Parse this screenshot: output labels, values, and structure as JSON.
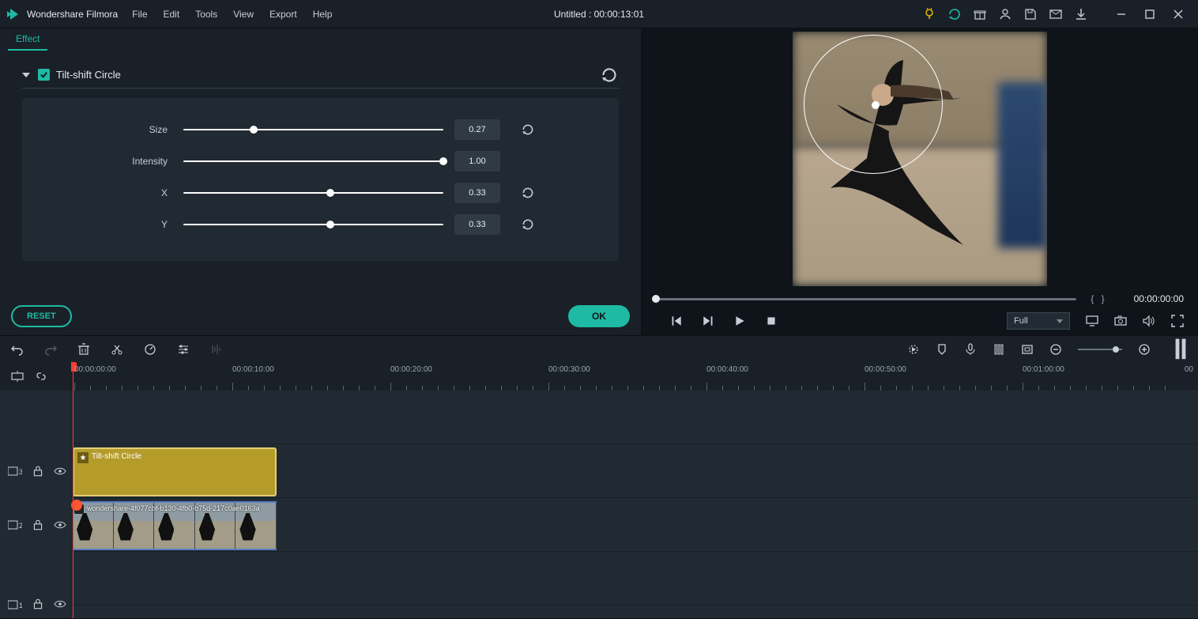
{
  "app": {
    "name": "Wondershare Filmora",
    "project": "Untitled : 00:00:13:01"
  },
  "menu": {
    "file": "File",
    "edit": "Edit",
    "tools": "Tools",
    "view": "View",
    "export": "Export",
    "help": "Help"
  },
  "tab": {
    "effect": "Effect"
  },
  "effect": {
    "name": "Tilt-shift Circle",
    "enabled": true,
    "params": {
      "size": {
        "label": "Size",
        "value": "0.27",
        "slider": 0.27
      },
      "intensity": {
        "label": "Intensity",
        "value": "1.00",
        "slider": 1.0
      },
      "x": {
        "label": "X",
        "value": "0.33",
        "slider": 0.565
      },
      "y": {
        "label": "Y",
        "value": "0.33",
        "slider": 0.565
      }
    }
  },
  "actions": {
    "reset": "RESET",
    "ok": "OK"
  },
  "preview": {
    "quality": "Full",
    "mark_brackets": "{         }",
    "time": "00:00:00:00"
  },
  "ruler": {
    "labels": [
      "00:00:00:00",
      "00:00:10:00",
      "00:00:20:00",
      "00:00:30:00",
      "00:00:40:00",
      "00:00:50:00",
      "00:01:00:00"
    ]
  },
  "tracks": {
    "t3": "3",
    "t2": "2",
    "t1": "1",
    "effect_clip_label": "Tilt-shift Circle",
    "video_clip_label": "wondershare-4f077cbf-b130-4fb0-b75d-217c0ae0163a"
  }
}
